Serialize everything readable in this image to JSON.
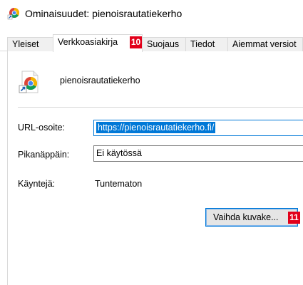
{
  "window": {
    "title": "Ominaisuudet: pienoisrautatiekerho",
    "icon": "chrome-shortcut-icon"
  },
  "tabs": [
    {
      "label": "Yleiset",
      "active": false
    },
    {
      "label": "Verkkoasiakirja",
      "active": true
    },
    {
      "label": "Suojaus",
      "active": false
    },
    {
      "label": "Tiedot",
      "active": false
    },
    {
      "label": "Aiemmat versiot",
      "active": false
    }
  ],
  "badges": {
    "tab": "10",
    "button": "11"
  },
  "shortcut": {
    "name": "pienoisrautatiekerho",
    "icon": "chrome-shortcut-icon"
  },
  "fields": {
    "url_label": "URL-osoite:",
    "url_value": "https://pienoisrautatiekerho.fi/",
    "hotkey_label": "Pikanäppäin:",
    "hotkey_value": "Ei käytössä",
    "visits_label": "Käyntejä:",
    "visits_value": "Tuntematon"
  },
  "buttons": {
    "change_icon": "Vaihda kuvake..."
  },
  "colors": {
    "selection": "#0078d7",
    "badge": "#e2001a"
  }
}
